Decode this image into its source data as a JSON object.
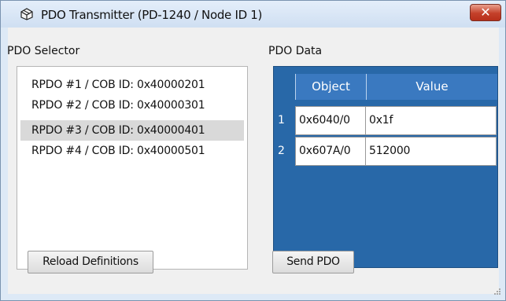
{
  "window": {
    "title": "PDO Transmitter (PD-1240 / Node ID  1)",
    "close_glyph": "✕"
  },
  "selector": {
    "label": "PDO Selector",
    "items": [
      {
        "label": "RPDO #1 / COB ID: 0x40000201"
      },
      {
        "label": "RPDO #2 / COB ID: 0x40000301"
      },
      {
        "label": "RPDO #3 / COB ID: 0x40000401"
      },
      {
        "label": "RPDO #4 / COB ID: 0x40000501"
      }
    ],
    "selected_index": 2,
    "reload_label": "Reload Definitions"
  },
  "data": {
    "label": "PDO Data",
    "columns": [
      "Object",
      "Value"
    ],
    "rows": [
      {
        "num": "1",
        "object": "0x6040/0",
        "value": "0x1f"
      },
      {
        "num": "2",
        "object": "0x607A/0",
        "value": "512000"
      }
    ],
    "send_label": "Send PDO"
  },
  "colors": {
    "grid_background": "#2868a8",
    "grid_header": "#3a79c0",
    "selected_row": "#d9d9d9",
    "close_button": "#c4402a"
  },
  "icons": {
    "title": "window-app-icon",
    "close": "close-icon",
    "grip": "resize-grip-icon"
  }
}
